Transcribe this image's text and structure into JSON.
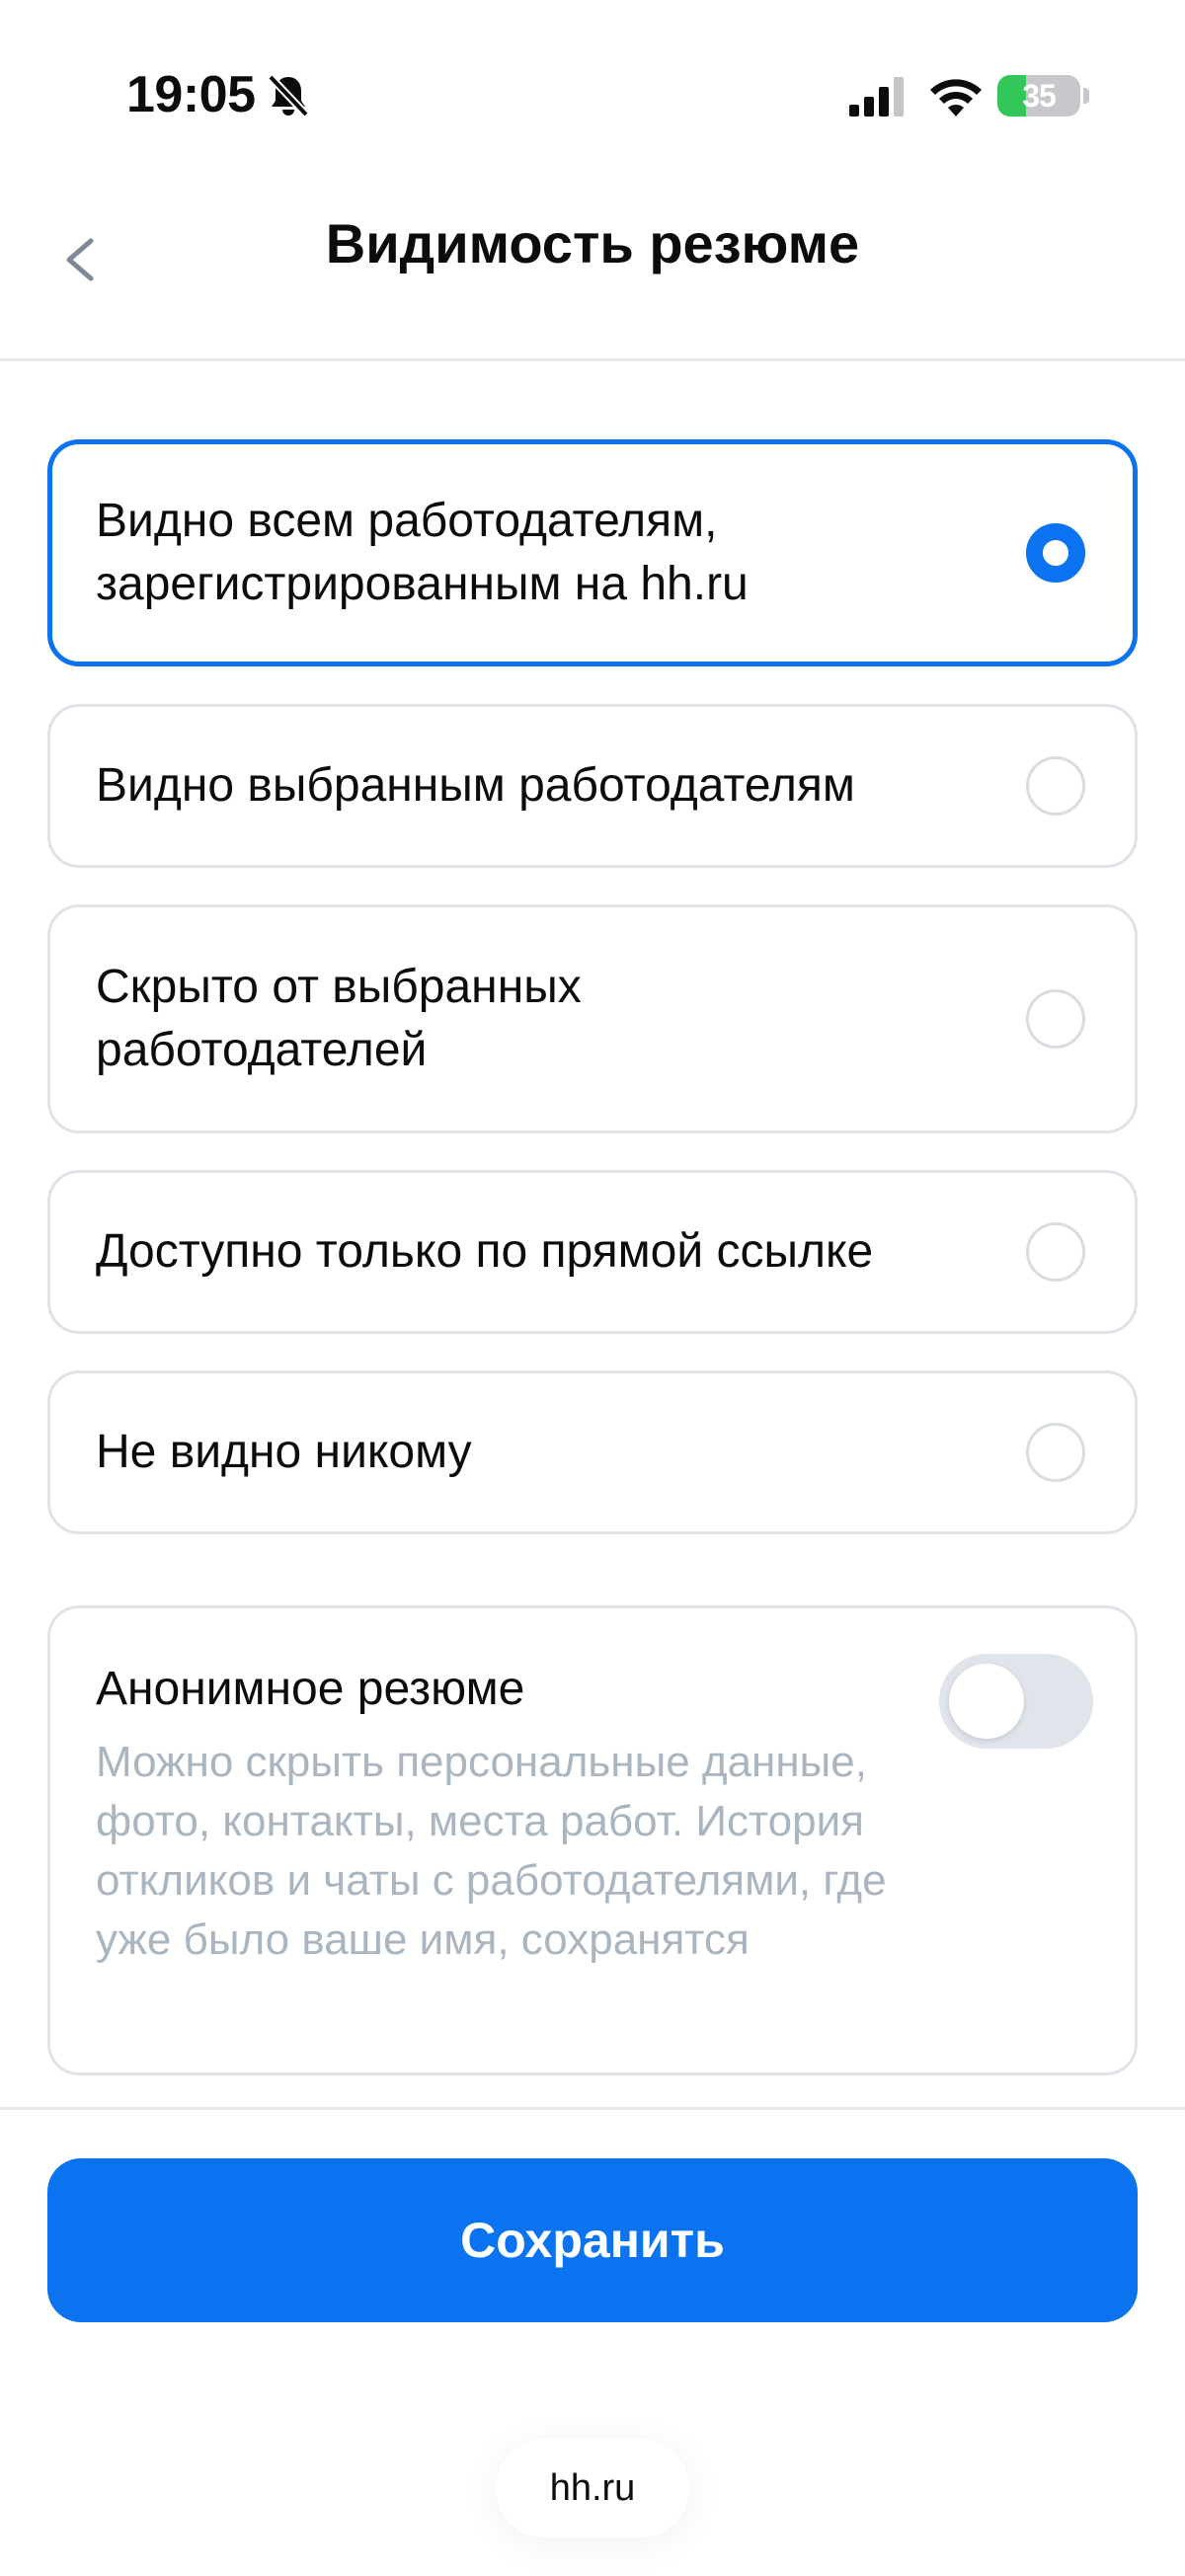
{
  "status_bar": {
    "time": "19:05",
    "battery_level": "35",
    "battery_fraction": 0.35,
    "icons": [
      "bell-off-icon",
      "cellular-signal-icon",
      "wifi-icon",
      "battery-charging-icon"
    ]
  },
  "header": {
    "title": "Видимость резюме",
    "back_icon": "chevron-left-icon"
  },
  "visibility_options": [
    {
      "label": "Видно всем работодателям, зарегистрированным на hh.ru",
      "selected": true
    },
    {
      "label": "Видно выбранным работодателям",
      "selected": false
    },
    {
      "label": "Скрыто от выбранных работодателей",
      "selected": false
    },
    {
      "label": "Доступно только по прямой ссылке",
      "selected": false
    },
    {
      "label": "Не видно никому",
      "selected": false
    }
  ],
  "anonymous": {
    "title": "Анонимное резюме",
    "description": "Можно скрыть персональные данные, фото, контакты, места работ. История откликов и чаты с работодателями, где уже было ваше имя, сохранятся",
    "enabled": false
  },
  "save_button": {
    "label": "Сохранить"
  },
  "browser": {
    "url": "hh.ru"
  },
  "colors": {
    "accent": "#0b72f0",
    "border": "#dfe3e8",
    "muted_text": "#a9b5c0",
    "toggle_off": "#dfe5eb",
    "battery_green": "#33c759"
  }
}
